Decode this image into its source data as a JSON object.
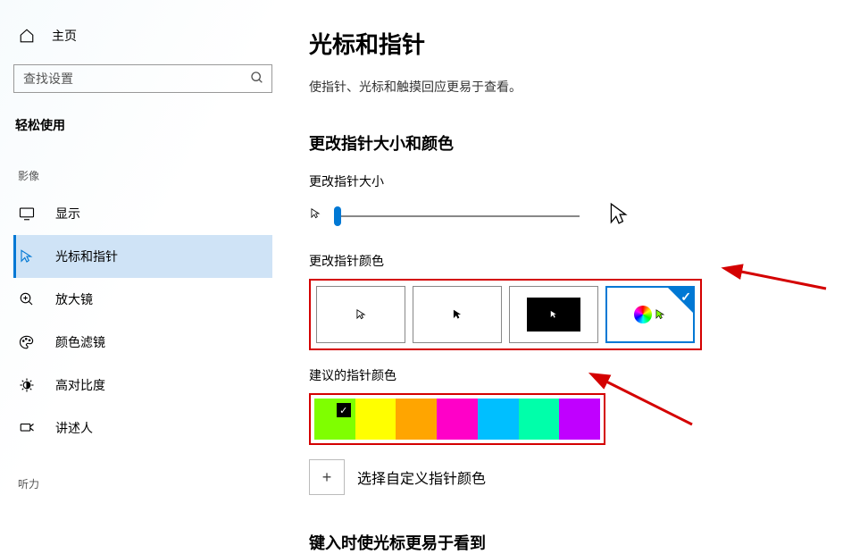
{
  "sidebar": {
    "home": "主页",
    "search_placeholder": "查找设置",
    "category": "轻松使用",
    "sections": {
      "vision": "影像",
      "hearing": "听力"
    },
    "items": [
      {
        "label": "显示"
      },
      {
        "label": "光标和指针"
      },
      {
        "label": "放大镜"
      },
      {
        "label": "颜色滤镜"
      },
      {
        "label": "高对比度"
      },
      {
        "label": "讲述人"
      }
    ]
  },
  "main": {
    "title": "光标和指针",
    "description": "使指针、光标和触摸回应更易于查看。",
    "subheading1": "更改指针大小和颜色",
    "size_label": "更改指针大小",
    "color_label": "更改指针颜色",
    "suggested_label": "建议的指针颜色",
    "custom_label": "选择自定义指针颜色",
    "subheading2": "键入时使光标更易于看到"
  },
  "colors": {
    "suggested": [
      "#7fff00",
      "#ffff00",
      "#ffa500",
      "#ff00c8",
      "#00bfff",
      "#00ffaa",
      "#c000ff"
    ]
  }
}
